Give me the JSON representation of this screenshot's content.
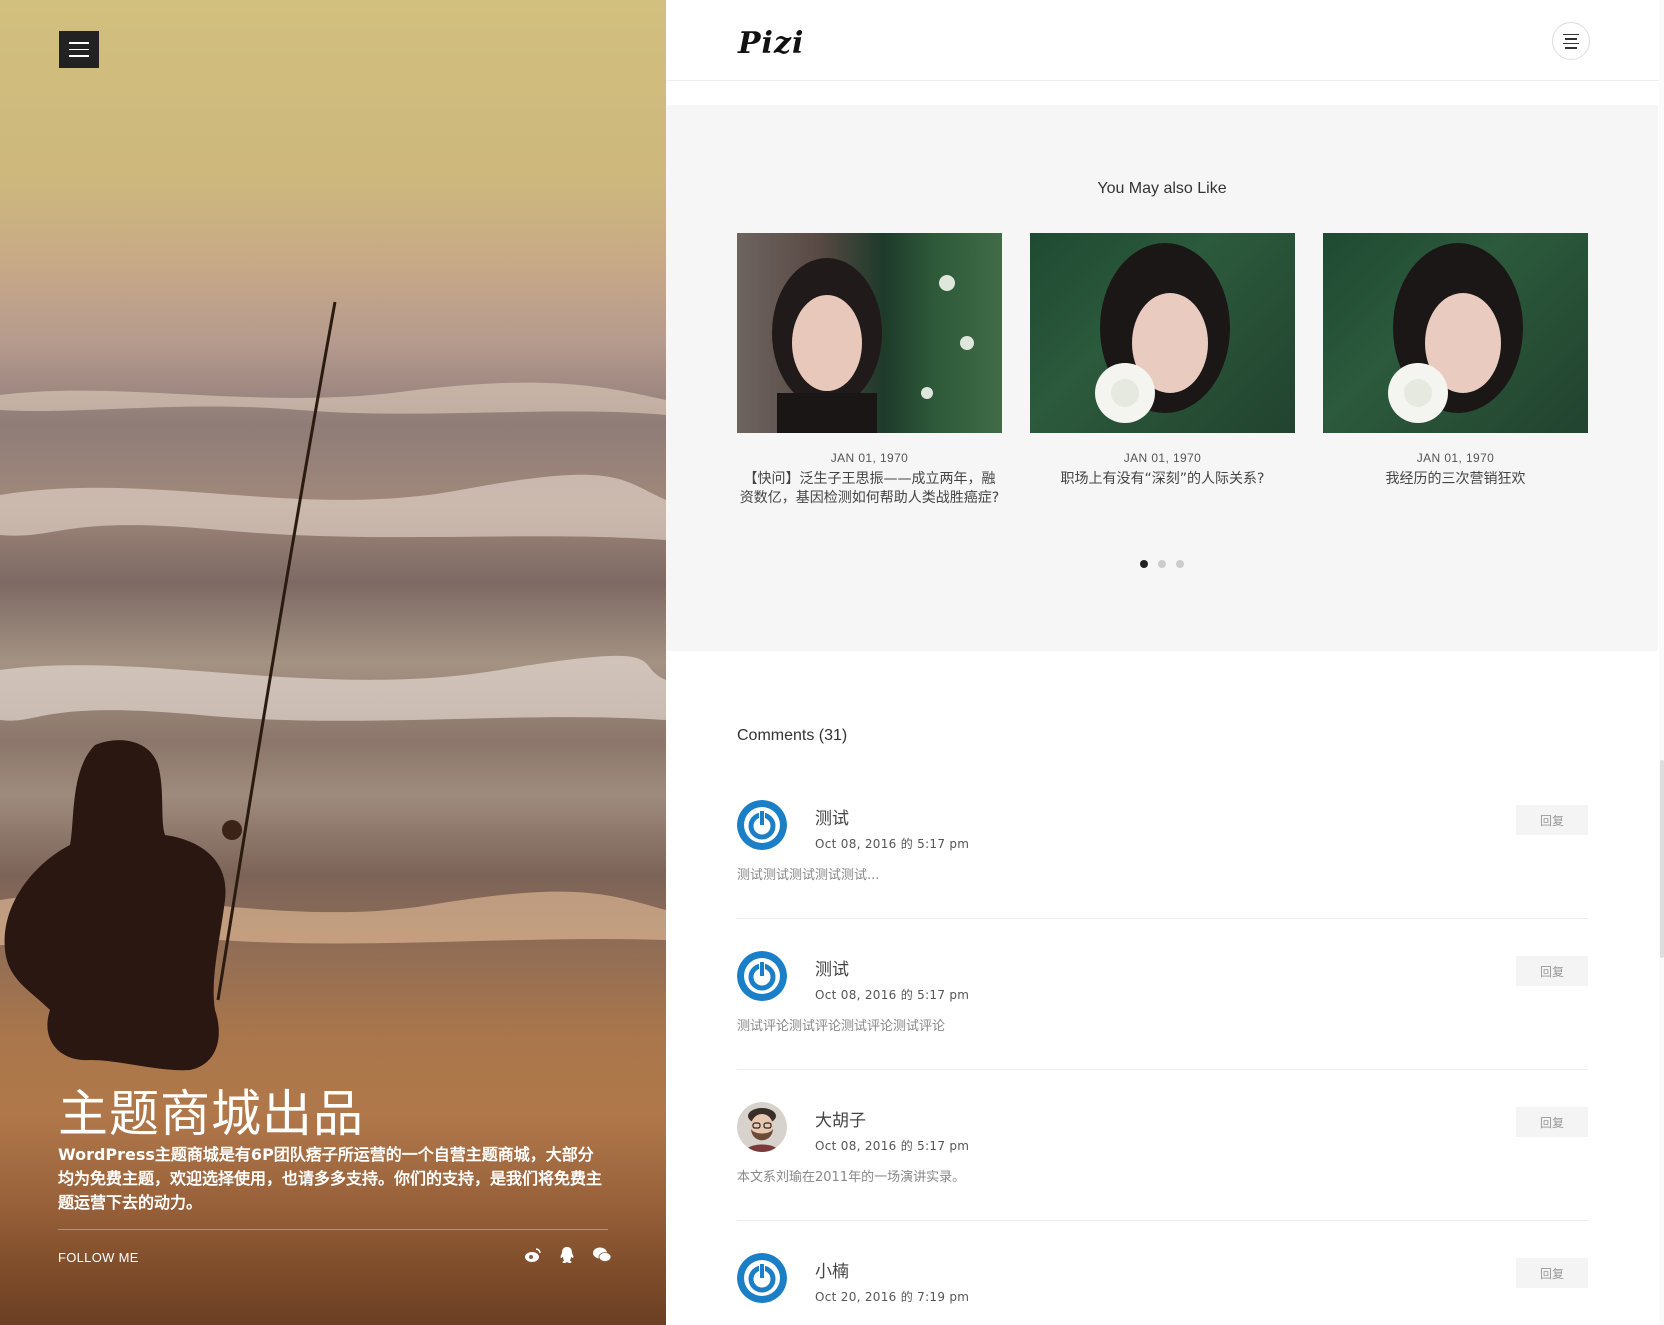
{
  "hero": {
    "menu_icon": "hamburger-icon",
    "title": "主题商城出品",
    "description": "WordPress主题商城是有6P团队痞子所运营的一个自营主题商城，大部分均为免费主题，欢迎选择使用，也请多多支持。你们的支持，是我们将免费主题运营下去的动力。",
    "follow_label": "FOLLOW ME",
    "social_icons": [
      "weibo-icon",
      "qq-icon",
      "wechat-icon"
    ]
  },
  "header": {
    "logo": "Pizi",
    "menu_icon": "menu-lines-icon"
  },
  "related": {
    "title": "You May also Like",
    "items": [
      {
        "date": "JAN 01, 1970",
        "title": "【快问】泛生子王思振——成立两年，融资数亿，基因检测如何帮助人类战胜癌症?"
      },
      {
        "date": "JAN 01, 1970",
        "title": "职场上有没有“深刻”的人际关系?"
      },
      {
        "date": "JAN 01, 1970",
        "title": "我经历的三次营销狂欢"
      }
    ],
    "pager": {
      "pages": 3,
      "active": 1
    }
  },
  "comments": {
    "title": "Comments (31)",
    "reply_label": "回复",
    "items": [
      {
        "name": "测试",
        "date": "Oct 08, 2016 的 5:17 pm",
        "text": "测试测试测试测试测试...",
        "avatar": "power-avatar-icon"
      },
      {
        "name": "测试",
        "date": "Oct 08, 2016 的 5:17 pm",
        "text": "测试评论测试评论测试评论测试评论",
        "avatar": "power-avatar-icon"
      },
      {
        "name": "大胡子",
        "date": "Oct 08, 2016 的 5:17 pm",
        "text": "本文系刘瑜在2011年的一场演讲实录。",
        "avatar": "bearded-man-avatar"
      },
      {
        "name": "小楠",
        "date": "Oct 20, 2016 的 7:19 pm",
        "text": "",
        "avatar": "power-avatar-icon"
      }
    ]
  },
  "colors": {
    "accent_blue": "#1a7fc6",
    "related_bg": "#f5f6f5",
    "dark": "#222222"
  }
}
